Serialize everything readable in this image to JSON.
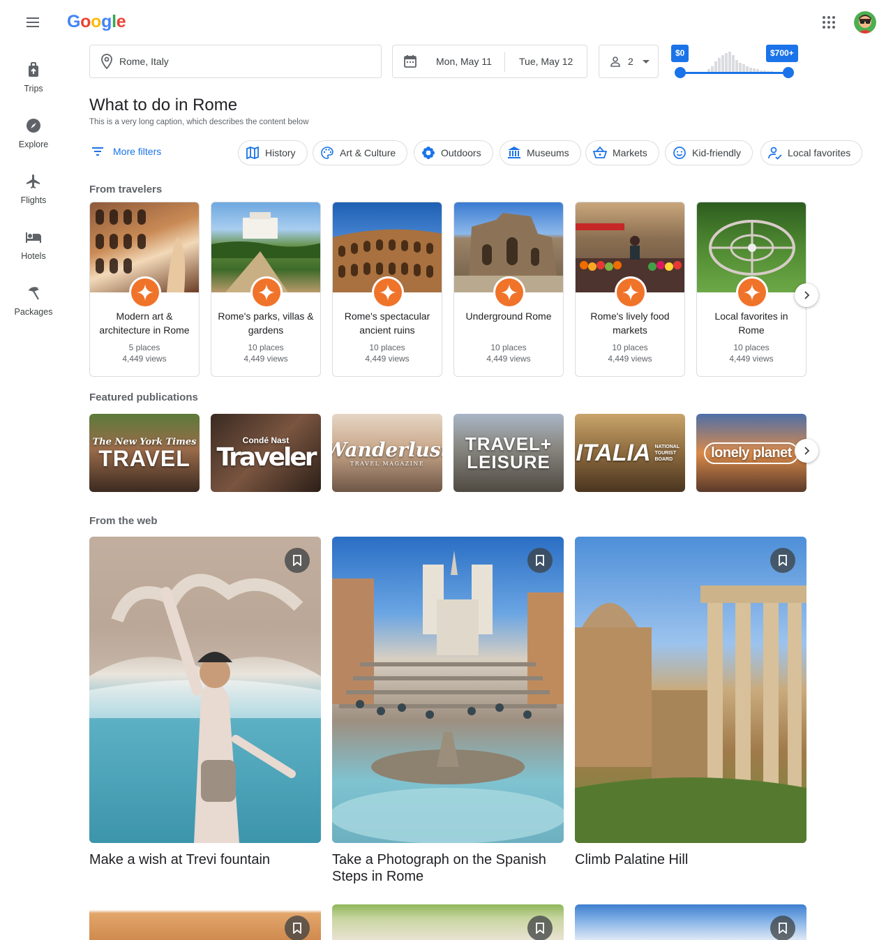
{
  "header": {
    "logo": [
      "G",
      "o",
      "o",
      "g",
      "l",
      "e"
    ],
    "logo_colors": [
      "#4285f4",
      "#ea4335",
      "#fbbc05",
      "#4285f4",
      "#34a853",
      "#ea4335"
    ]
  },
  "nav": {
    "items": [
      {
        "label": "Trips",
        "icon": "luggage-icon"
      },
      {
        "label": "Explore",
        "icon": "compass-icon"
      },
      {
        "label": "Flights",
        "icon": "airplane-icon"
      },
      {
        "label": "Hotels",
        "icon": "bed-icon"
      },
      {
        "label": "Packages",
        "icon": "beach-umbrella-icon"
      }
    ]
  },
  "search": {
    "location": "Rome, Italy",
    "check_in": "Mon, May 11",
    "check_out": "Tue, May 12",
    "guests": "2",
    "price_min": "$0",
    "price_max": "$700+",
    "price_histogram": [
      4,
      8,
      14,
      18,
      22,
      24,
      26,
      22,
      16,
      12,
      10,
      8,
      6,
      5,
      4,
      3,
      3,
      2,
      2
    ]
  },
  "page": {
    "title": "What to do in Rome",
    "caption": "This is a very long caption, which describes the content below"
  },
  "filters": {
    "more": "More filters",
    "chips": [
      {
        "label": "History",
        "icon": "map-icon"
      },
      {
        "label": "Art & Culture",
        "icon": "palette-icon"
      },
      {
        "label": "Outdoors",
        "icon": "gear-flower-icon"
      },
      {
        "label": "Museums",
        "icon": "museum-icon"
      },
      {
        "label": "Markets",
        "icon": "basket-icon"
      },
      {
        "label": "Kid-friendly",
        "icon": "smiley-icon"
      },
      {
        "label": "Local favorites",
        "icon": "person-check-icon"
      }
    ]
  },
  "sections": {
    "travelers": "From travelers",
    "publications": "Featured publications",
    "web": "From the web"
  },
  "traveler_cards": [
    {
      "title": "Modern art & architecture in Rome",
      "places": "5 places",
      "views": "4,449 views"
    },
    {
      "title": "Rome's parks, villas & gardens",
      "places": "10 places",
      "views": "4,449 views"
    },
    {
      "title": "Rome's spectacular ancient ruins",
      "places": "10 places",
      "views": "4,449 views"
    },
    {
      "title": "Underground Rome",
      "places": "10 places",
      "views": "4,449 views"
    },
    {
      "title": "Rome's lively food markets",
      "places": "10 places",
      "views": "4,449 views"
    },
    {
      "title": "Local favorites in Rome",
      "places": "10 places",
      "views": "4,449 views"
    }
  ],
  "publications": [
    {
      "line1": "The New York Times",
      "line2": "TRAVEL"
    },
    {
      "line1": "Condé Nast",
      "line2": "Traveler"
    },
    {
      "line1": "Wanderlust",
      "line2": "TRAVEL MAGAZINE"
    },
    {
      "line1": "TRAVEL+",
      "line2": "LEISURE"
    },
    {
      "line1": "ITALIA",
      "line2": "NATIONAL TOURIST BOARD"
    },
    {
      "line1": "lonely planet",
      "line2": ""
    }
  ],
  "web_cards": [
    {
      "title": "Make a wish at Trevi fountain"
    },
    {
      "title": "Take a Photograph on the Spanish Steps in Rome"
    },
    {
      "title": "Climb Palatine Hill"
    }
  ]
}
